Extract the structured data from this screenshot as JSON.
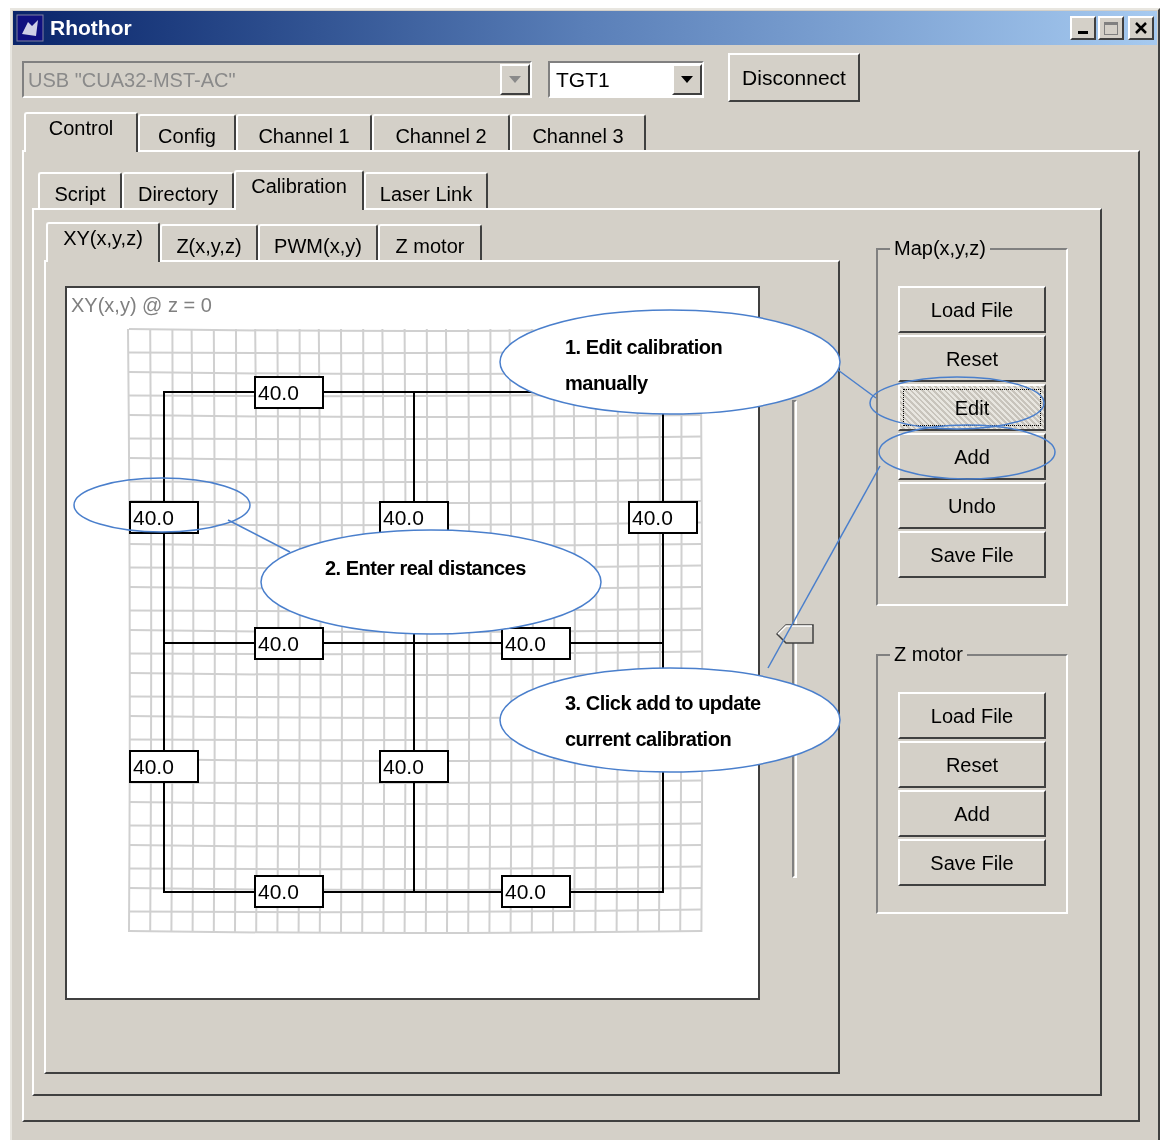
{
  "window": {
    "title": "Rhothor"
  },
  "connection": {
    "port": {
      "value": "USB \"CUA32-MST-AC\"",
      "disabled": true
    },
    "target": {
      "value": "TGT1",
      "disabled": false
    },
    "button": "Disconnect"
  },
  "main_tabs": [
    {
      "label": "Control",
      "selected": true
    },
    {
      "label": "Config",
      "selected": false
    },
    {
      "label": "Channel 1",
      "selected": false
    },
    {
      "label": "Channel 2",
      "selected": false
    },
    {
      "label": "Channel 3",
      "selected": false
    }
  ],
  "sub_tabs": [
    {
      "label": "Script",
      "selected": false
    },
    {
      "label": "Directory",
      "selected": false
    },
    {
      "label": "Calibration",
      "selected": true
    },
    {
      "label": "Laser Link",
      "selected": false
    }
  ],
  "calibration_tabs": [
    {
      "label": "XY(x,y,z)",
      "selected": true
    },
    {
      "label": "Z(x,y,z)",
      "selected": false
    },
    {
      "label": "PWM(x,y)",
      "selected": false
    },
    {
      "label": "Z motor",
      "selected": false
    }
  ],
  "plot": {
    "title": "XY(x,y) @ z = 0",
    "fields": [
      {
        "value": "40.0"
      },
      {
        "value": "40.0"
      },
      {
        "value": "40.0"
      },
      {
        "value": "40.0"
      },
      {
        "value": "40.0"
      },
      {
        "value": "40.0"
      },
      {
        "value": "40.0"
      },
      {
        "value": "40.0"
      },
      {
        "value": "40.0"
      },
      {
        "value": "40.0"
      }
    ]
  },
  "slider": {
    "level": 0.51
  },
  "map_group": {
    "title": "Map(x,y,z)",
    "buttons": [
      {
        "label": "Load File",
        "focused": false
      },
      {
        "label": "Reset",
        "focused": false
      },
      {
        "label": "Edit",
        "focused": true
      },
      {
        "label": "Add",
        "focused": false
      },
      {
        "label": "Undo",
        "focused": false
      },
      {
        "label": "Save File",
        "focused": false
      }
    ]
  },
  "z_motor_group": {
    "title": "Z motor",
    "buttons": [
      {
        "label": "Load File",
        "focused": false
      },
      {
        "label": "Reset",
        "focused": false
      },
      {
        "label": "Add",
        "focused": false
      },
      {
        "label": "Save File",
        "focused": false
      }
    ]
  },
  "callouts": [
    {
      "lines": [
        "1. Edit calibration",
        "manually"
      ]
    },
    {
      "lines": [
        "2. Enter real distances"
      ]
    },
    {
      "lines": [
        "3. Click add to update",
        "current calibration"
      ]
    }
  ]
}
